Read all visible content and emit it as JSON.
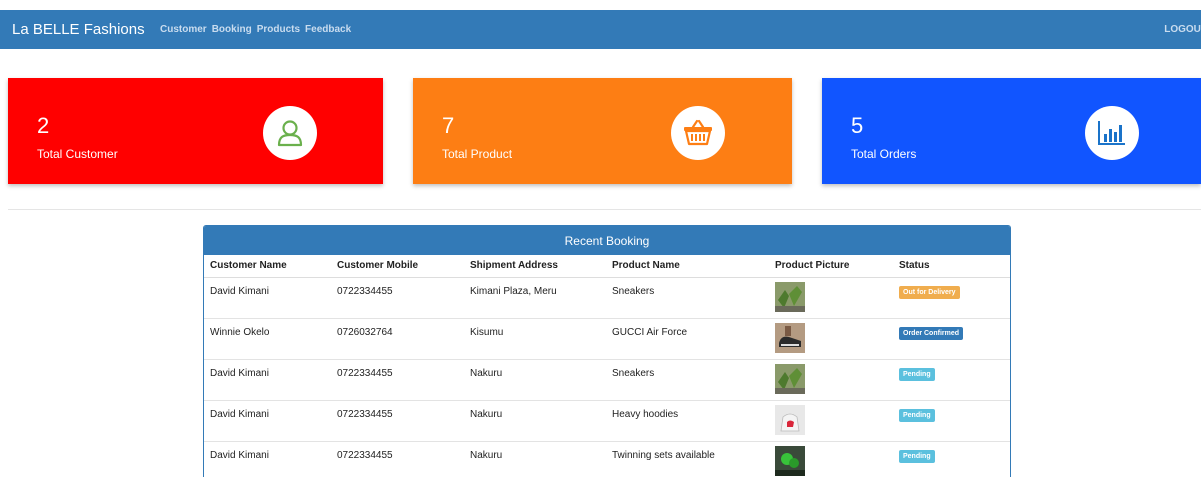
{
  "nav": {
    "brand": "La BELLE Fashions",
    "links": [
      "Customer",
      "Booking",
      "Products",
      "Feedback"
    ],
    "logout": "LOGOUT"
  },
  "cards": [
    {
      "value": "2",
      "label": "Total Customer",
      "icon": "user-icon",
      "color": "#ff0000"
    },
    {
      "value": "7",
      "label": "Total Product",
      "icon": "basket-icon",
      "color": "#fd7e14"
    },
    {
      "value": "5",
      "label": "Total Orders",
      "icon": "bar-chart-icon",
      "color": "#1155ff"
    }
  ],
  "booking": {
    "title": "Recent Booking",
    "columns": [
      "Customer Name",
      "Customer Mobile",
      "Shipment Address",
      "Product Name",
      "Product Picture",
      "Status"
    ],
    "rows": [
      {
        "name": "David Kimani",
        "mobile": "0722334455",
        "address": "Kimani Plaza, Meru",
        "product": "Sneakers",
        "picture": "sneakers-thumbnail",
        "status": "Out for Delivery",
        "status_color": "#f0ad4e"
      },
      {
        "name": "Winnie Okelo",
        "mobile": "0726032764",
        "address": "Kisumu",
        "product": "GUCCI Air Force",
        "picture": "air-force-thumbnail",
        "status": "Order Confirmed",
        "status_color": "#337ab7"
      },
      {
        "name": "David Kimani",
        "mobile": "0722334455",
        "address": "Nakuru",
        "product": "Sneakers",
        "picture": "sneakers-thumbnail",
        "status": "Pending",
        "status_color": "#5bc0de"
      },
      {
        "name": "David Kimani",
        "mobile": "0722334455",
        "address": "Nakuru",
        "product": "Heavy hoodies",
        "picture": "hoodie-thumbnail",
        "status": "Pending",
        "status_color": "#5bc0de"
      },
      {
        "name": "David Kimani",
        "mobile": "0722334455",
        "address": "Nakuru",
        "product": "Twinning sets available",
        "picture": "twinning-set-thumbnail",
        "status": "Pending",
        "status_color": "#5bc0de"
      }
    ]
  }
}
